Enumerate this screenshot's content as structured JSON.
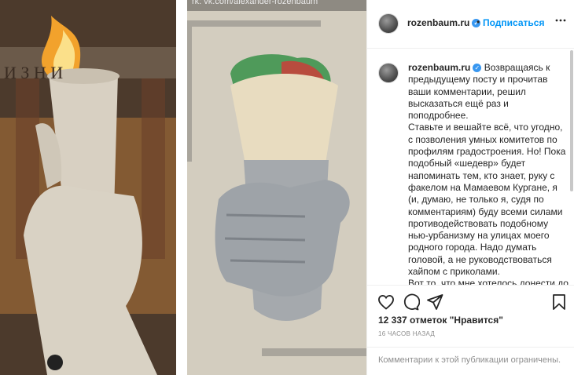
{
  "media": {
    "top_caption": "rk: vk.com/alexander-rozenbaum",
    "left_photo_inscription": "И З Н И",
    "left_photo_alt_icon": "torch-sculpture-image",
    "right_photo_alt_icon": "shawarma-sculpture-image"
  },
  "header": {
    "username": "rozenbaum.ru",
    "dot": "•",
    "follow_label": "Подписаться",
    "more_icon": "more-options-icon"
  },
  "post": {
    "username": "rozenbaum.ru",
    "caption": "Возвращаясь к предыдущему посту и прочитав ваши комментарии, решил высказаться ещё раз и поподробнее.",
    "body_1": "Ставьте и вешайте всё, что угодно, с позволения умных комитетов по профилям градостроения. Но! Пока подобный «шедевр» будет напоминать тем, кто знает, руку с факелом на Мамаевом Кургане, я (и, думаю, не только я, судя по комментариям) буду всеми силами противодействовать подобному нью-урбанизму на улицах моего родного города. Надо думать головой, а не руководствоваться хайпом с приколами.",
    "body_2": "Вот то, что мне хотелось донести до вас, уважаемые мои подписчики."
  },
  "actions": {
    "like_icon": "heart-icon",
    "comment_icon": "comment-icon",
    "share_icon": "paper-plane-icon",
    "save_icon": "bookmark-icon",
    "likes_text": "12 337 отметок \"Нравится\"",
    "time_text": "16 ЧАСОВ НАЗАД"
  },
  "footer": {
    "limited_text": "Комментарии к этой публикации ограничены."
  },
  "colors": {
    "accent": "#0095f6",
    "verified": "#3897f0",
    "muted": "#8e8e8e",
    "border": "#efefef"
  }
}
